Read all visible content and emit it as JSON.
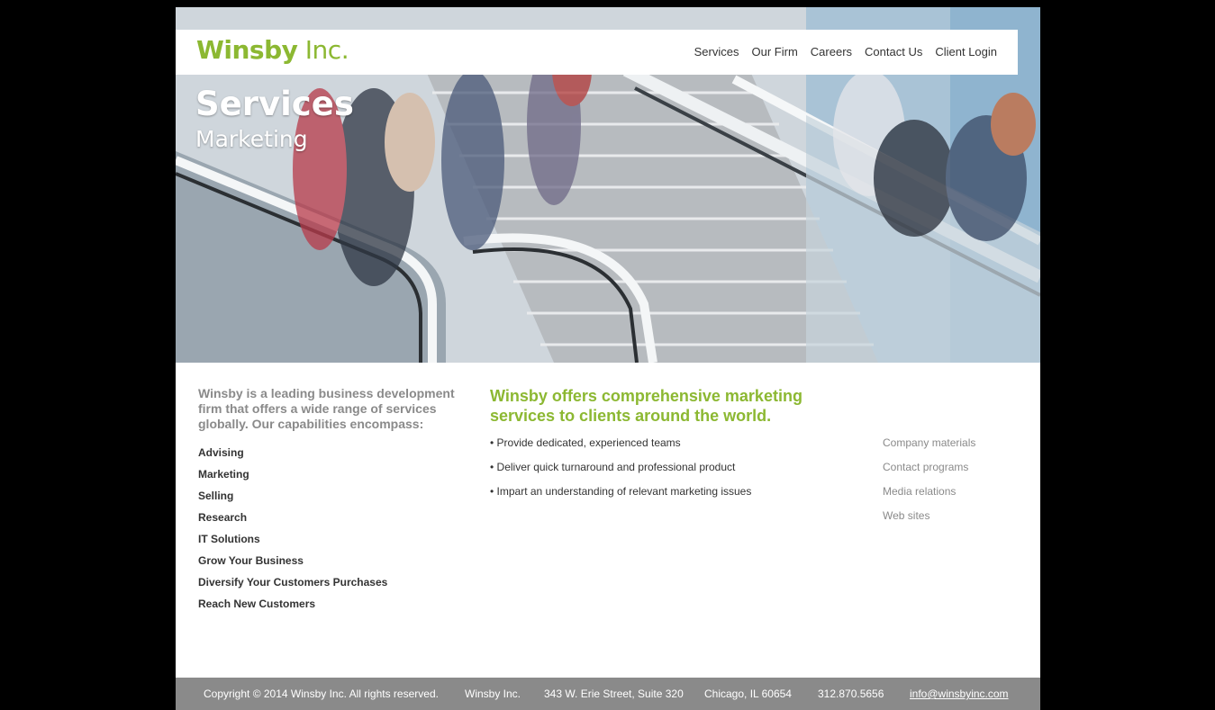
{
  "brand": {
    "name_bold": "Winsby",
    "name_light": " Inc.",
    "accent_color": "#8cb832"
  },
  "nav": {
    "items": [
      "Services",
      "Our Firm",
      "Careers",
      "Contact Us",
      "Client Login"
    ]
  },
  "hero": {
    "title": "Services",
    "subtitle": "Marketing"
  },
  "intro": {
    "text": "Winsby is a leading business development firm that offers a wide range of services globally. Our capabilities encompass:"
  },
  "capabilities": [
    "Advising",
    "Marketing",
    "Selling",
    "Research",
    "IT Solutions",
    "Grow Your Business",
    "Diversify Your Customers Purchases",
    "Reach New Customers"
  ],
  "main": {
    "headline": "Winsby offers comprehensive marketing services to clients around the world.",
    "bullets": [
      "• Provide dedicated, experienced teams",
      "• Deliver quick turnaround and professional product",
      "• Impart an understanding of relevant marketing issues"
    ]
  },
  "side_links": [
    "Company materials",
    "Contact programs",
    "Media relations",
    "Web sites"
  ],
  "footer": {
    "copyright": "Copyright © 2014 Winsby Inc. All rights reserved.",
    "company": "Winsby Inc.",
    "address": "343 W. Erie Street, Suite 320",
    "city": "Chicago, IL 60654",
    "phone": "312.870.5656",
    "email": "info@winsbyinc.com"
  }
}
